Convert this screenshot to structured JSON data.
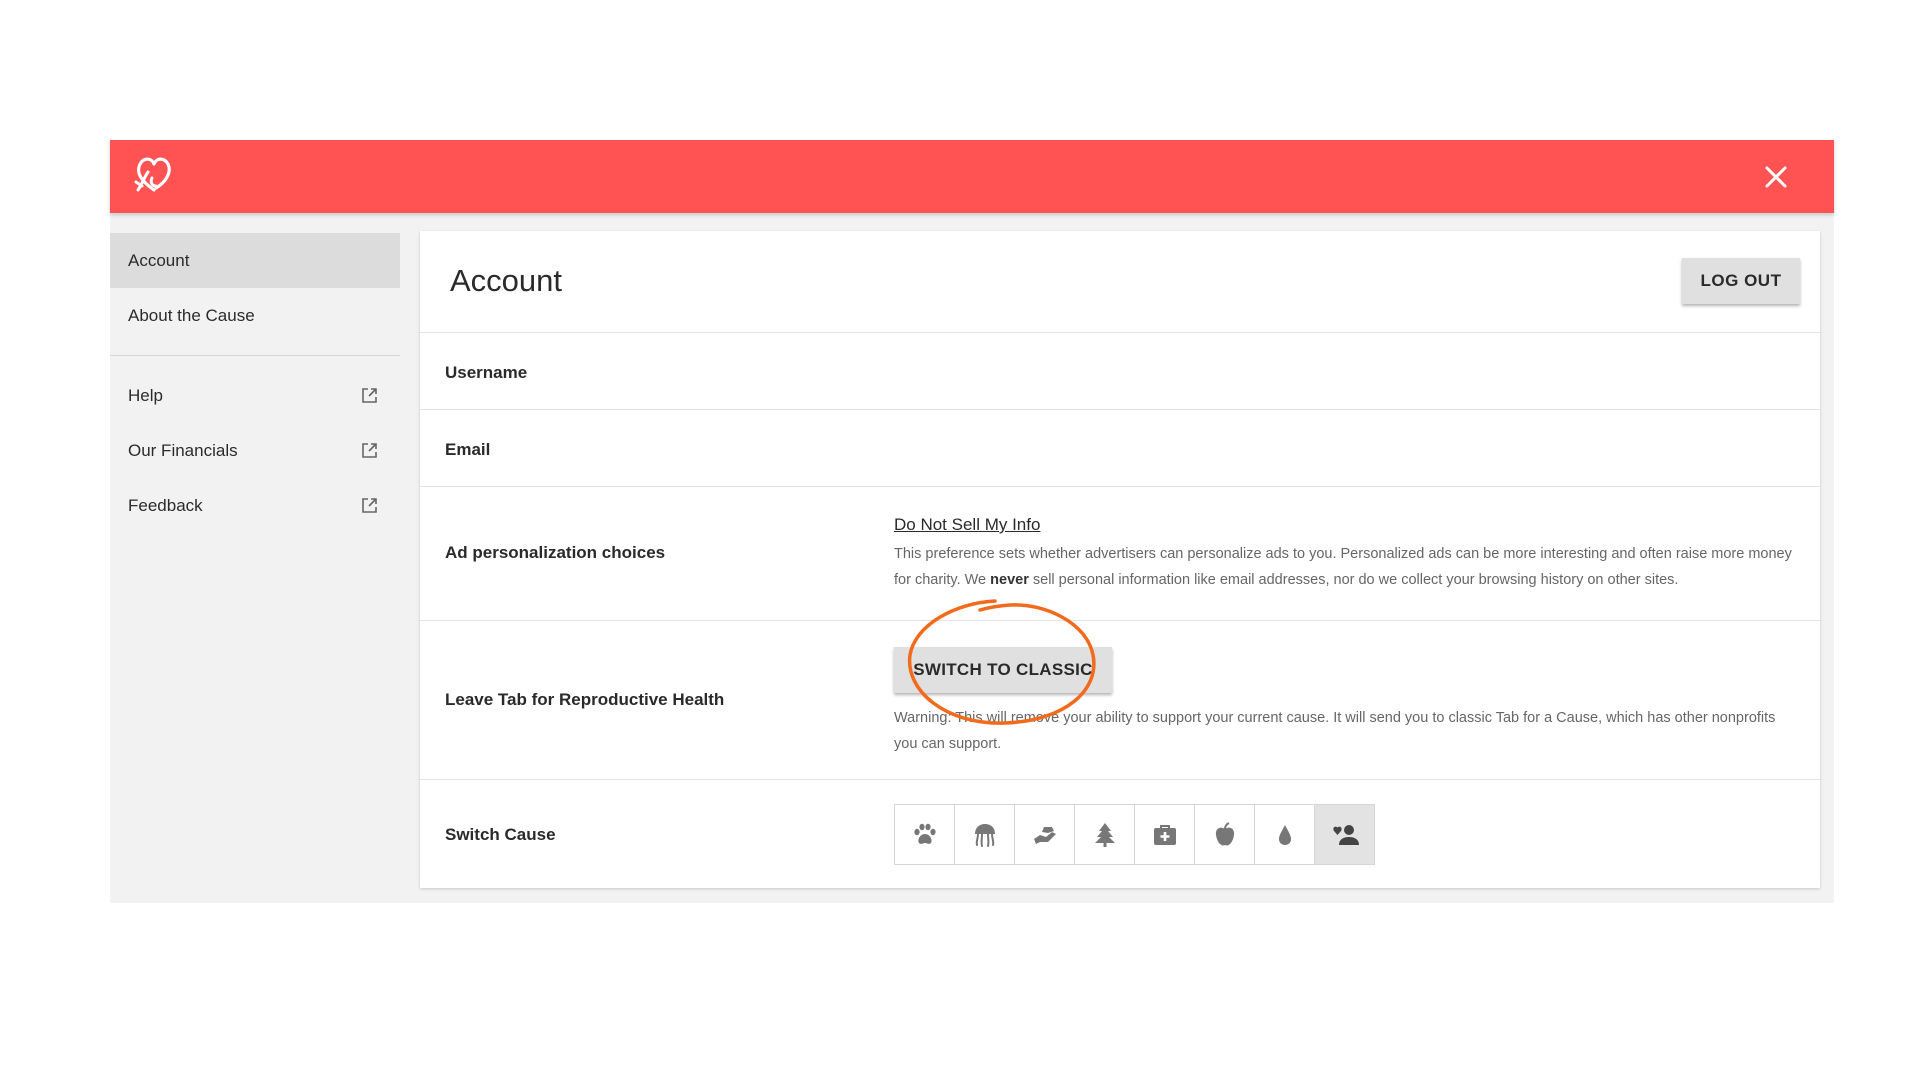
{
  "colors": {
    "brand": "#fe5253",
    "annotation": "#f26a1b"
  },
  "header": {
    "logo_icon": "heart-balloon-icon",
    "close_icon": "close-icon"
  },
  "sidebar": {
    "items": [
      {
        "label": "Account",
        "active": true
      },
      {
        "label": "About the Cause",
        "active": false
      }
    ],
    "external_items": [
      {
        "label": "Help",
        "icon": "external-link-icon"
      },
      {
        "label": "Our Financials",
        "icon": "external-link-icon"
      },
      {
        "label": "Feedback",
        "icon": "external-link-icon"
      }
    ]
  },
  "main": {
    "title": "Account",
    "logout_label": "LOG OUT",
    "rows": {
      "username_label": "Username",
      "email_label": "Email",
      "ads_label": "Ad personalization choices",
      "ads_link": "Do Not Sell My Info",
      "ads_desc_1": "This preference sets whether advertisers can personalize ads to you. Personalized ads can be more interesting and often raise more money for charity. We ",
      "ads_desc_bold": "never",
      "ads_desc_2": " sell personal information like email addresses, nor do we collect your browsing history on other sites.",
      "leave_label": "Leave Tab for Reproductive Health",
      "switch_classic_label": "SWITCH TO CLASSIC",
      "leave_warning": "Warning: This will remove your ability to support your current cause. It will send you to classic Tab for a Cause, which has other nonprofits you can support.",
      "switch_cause_label": "Switch Cause"
    },
    "causes": [
      {
        "icon": "paw-icon",
        "selected": false
      },
      {
        "icon": "jellyfish-icon",
        "selected": false
      },
      {
        "icon": "helping-hand-icon",
        "selected": false
      },
      {
        "icon": "tree-icon",
        "selected": false
      },
      {
        "icon": "medical-kit-icon",
        "selected": false
      },
      {
        "icon": "apple-icon",
        "selected": false
      },
      {
        "icon": "water-drop-icon",
        "selected": false
      },
      {
        "icon": "person-heart-icon",
        "selected": true
      }
    ]
  }
}
